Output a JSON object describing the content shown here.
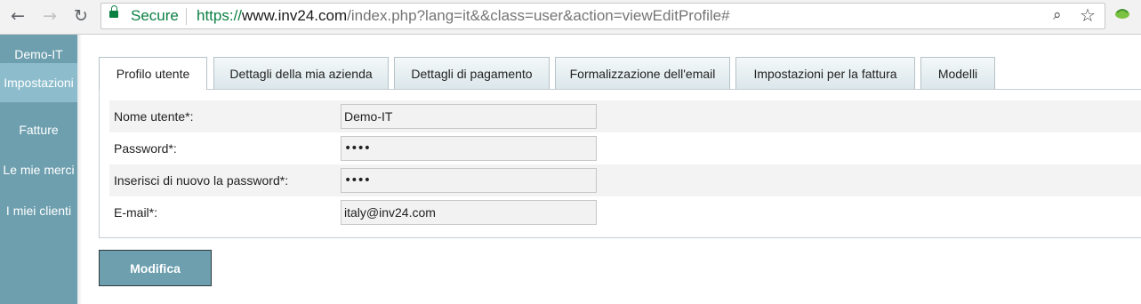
{
  "browser": {
    "secure_label": "Secure",
    "url_scheme": "https://",
    "url_host": "www.inv24.com",
    "url_path": "/index.php?lang=it&&class=user&action=viewEditProfile#"
  },
  "sidebar": {
    "items": [
      {
        "label": "Demo-IT"
      },
      {
        "label": "Impostazioni"
      },
      {
        "label": "Fatture"
      },
      {
        "label": "Le mie merci"
      },
      {
        "label": "I miei clienti"
      }
    ],
    "active_index": 1
  },
  "tabs": [
    {
      "label": "Profilo utente"
    },
    {
      "label": "Dettagli della mia azienda"
    },
    {
      "label": "Dettagli di pagamento"
    },
    {
      "label": "Formalizzazione dell'email"
    },
    {
      "label": "Impostazioni per la fattura"
    },
    {
      "label": "Modelli"
    }
  ],
  "active_tab": 0,
  "form": {
    "fields": [
      {
        "label": "Nome utente*:",
        "value": "Demo-IT"
      },
      {
        "label": "Password*:",
        "value": "••••"
      },
      {
        "label": "Inserisci di nuovo la password*:",
        "value": "••••"
      },
      {
        "label": "E-mail*:",
        "value": "italy@inv24.com"
      }
    ]
  },
  "submit_label": "Modifica",
  "colors": {
    "sidebar": "#6d9fae",
    "sidebar_active": "#8dbdcc",
    "secure_green": "#0b8043"
  }
}
